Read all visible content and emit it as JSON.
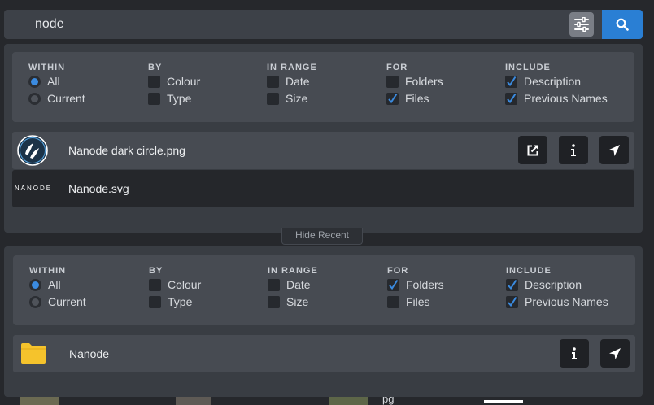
{
  "search": {
    "query": "node"
  },
  "icons": {
    "filter_toggle": "sliders-icon",
    "search": "search-icon",
    "open_external": "external-link-icon",
    "info": "info-icon",
    "locate": "location-arrow-icon",
    "folder": "folder-icon"
  },
  "colors": {
    "accent": "#2a7fd4",
    "folder": "#f5c32c",
    "checkmark": "#3b8be0"
  },
  "hide_recent_label": "Hide Recent",
  "panels": [
    {
      "filters": {
        "within": {
          "heading": "WITHIN",
          "options": [
            {
              "label": "All",
              "selected": true
            },
            {
              "label": "Current",
              "selected": false
            }
          ]
        },
        "by": {
          "heading": "BY",
          "options": [
            {
              "label": "Colour",
              "checked": false
            },
            {
              "label": "Type",
              "checked": false
            }
          ]
        },
        "in_range": {
          "heading": "IN RANGE",
          "options": [
            {
              "label": "Date",
              "checked": false
            },
            {
              "label": "Size",
              "checked": false
            }
          ]
        },
        "for": {
          "heading": "FOR",
          "options": [
            {
              "label": "Folders",
              "checked": false
            },
            {
              "label": "Files",
              "checked": true
            }
          ]
        },
        "include": {
          "heading": "INCLUDE",
          "options": [
            {
              "label": "Description",
              "checked": true
            },
            {
              "label": "Previous Names",
              "checked": true
            }
          ]
        }
      },
      "results": [
        {
          "name": "Nanode dark circle.png",
          "thumb": "nanode-logo-icon"
        },
        {
          "name": "Nanode.svg",
          "thumb_text": "NANODE"
        }
      ]
    },
    {
      "filters": {
        "within": {
          "heading": "WITHIN",
          "options": [
            {
              "label": "All",
              "selected": true
            },
            {
              "label": "Current",
              "selected": false
            }
          ]
        },
        "by": {
          "heading": "BY",
          "options": [
            {
              "label": "Colour",
              "checked": false
            },
            {
              "label": "Type",
              "checked": false
            }
          ]
        },
        "in_range": {
          "heading": "IN RANGE",
          "options": [
            {
              "label": "Date",
              "checked": false
            },
            {
              "label": "Size",
              "checked": false
            }
          ]
        },
        "for": {
          "heading": "FOR",
          "options": [
            {
              "label": "Folders",
              "checked": true
            },
            {
              "label": "Files",
              "checked": false
            }
          ]
        },
        "include": {
          "heading": "INCLUDE",
          "options": [
            {
              "label": "Description",
              "checked": true
            },
            {
              "label": "Previous Names",
              "checked": true
            }
          ]
        }
      },
      "results": [
        {
          "name": "Nanode",
          "thumb": "folder-icon"
        }
      ]
    }
  ],
  "background_fragment_text": "pg"
}
